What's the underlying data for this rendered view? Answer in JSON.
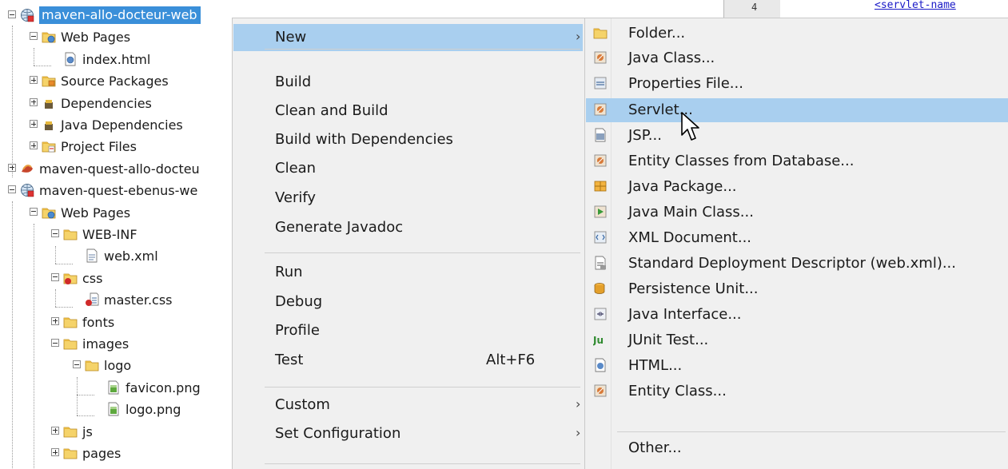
{
  "tree": {
    "items": [
      {
        "label": "maven-allo-docteur-web",
        "icon": "web-project-icon",
        "expander": "minus",
        "selected": true
      },
      {
        "label": "Web Pages",
        "icon": "web-pages-folder-icon",
        "expander": "minus"
      },
      {
        "label": "index.html",
        "icon": "html-file-icon",
        "expander": ""
      },
      {
        "label": "Source Packages",
        "icon": "source-packages-folder-icon",
        "expander": "plus"
      },
      {
        "label": "Dependencies",
        "icon": "dependencies-folder-icon",
        "expander": "plus"
      },
      {
        "label": "Java Dependencies",
        "icon": "java-dependencies-folder-icon",
        "expander": "plus"
      },
      {
        "label": "Project Files",
        "icon": "project-files-folder-icon",
        "expander": "plus"
      },
      {
        "label": "maven-quest-allo-docteu",
        "icon": "maven-project-icon",
        "expander": "plus"
      },
      {
        "label": "maven-quest-ebenus-we",
        "icon": "web-project-icon",
        "expander": "minus"
      },
      {
        "label": "Web Pages",
        "icon": "web-pages-folder-icon",
        "expander": "minus"
      },
      {
        "label": "WEB-INF",
        "icon": "folder-icon",
        "expander": "minus"
      },
      {
        "label": "web.xml",
        "icon": "xml-file-icon",
        "expander": ""
      },
      {
        "label": "css",
        "icon": "folder-error-icon",
        "expander": "minus"
      },
      {
        "label": "master.css",
        "icon": "css-file-icon",
        "expander": ""
      },
      {
        "label": "fonts",
        "icon": "folder-icon",
        "expander": "plus"
      },
      {
        "label": "images",
        "icon": "folder-icon",
        "expander": "minus"
      },
      {
        "label": "logo",
        "icon": "folder-icon",
        "expander": "minus"
      },
      {
        "label": "favicon.png",
        "icon": "image-file-icon",
        "expander": ""
      },
      {
        "label": "logo.png",
        "icon": "image-file-icon",
        "expander": ""
      },
      {
        "label": "js",
        "icon": "folder-icon",
        "expander": "plus"
      },
      {
        "label": "pages",
        "icon": "folder-icon",
        "expander": "plus"
      }
    ]
  },
  "editor": {
    "line_number": "4",
    "code": "<servlet-name"
  },
  "context_menu": {
    "items": [
      {
        "label": "New",
        "shortcut": "",
        "submenu": true,
        "highlighted": true
      },
      {
        "label": "Build",
        "shortcut": "",
        "submenu": false
      },
      {
        "label": "Clean and Build",
        "shortcut": "",
        "submenu": false
      },
      {
        "label": "Build with Dependencies",
        "shortcut": "",
        "submenu": false
      },
      {
        "label": "Clean",
        "shortcut": "",
        "submenu": false
      },
      {
        "label": "Verify",
        "shortcut": "",
        "submenu": false
      },
      {
        "label": "Generate Javadoc",
        "shortcut": "",
        "submenu": false
      },
      {
        "label": "Run",
        "shortcut": "",
        "submenu": false
      },
      {
        "label": "Debug",
        "shortcut": "",
        "submenu": false
      },
      {
        "label": "Profile",
        "shortcut": "",
        "submenu": false
      },
      {
        "label": "Test",
        "shortcut": "Alt+F6",
        "submenu": false
      },
      {
        "label": "Custom",
        "shortcut": "",
        "submenu": true
      },
      {
        "label": "Set Configuration",
        "shortcut": "",
        "submenu": true
      }
    ]
  },
  "new_submenu": {
    "items": [
      {
        "label": "Folder...",
        "icon": "folder-icon"
      },
      {
        "label": "Java Class...",
        "icon": "java-class-icon"
      },
      {
        "label": "Properties File...",
        "icon": "properties-file-icon"
      },
      {
        "label": "Servlet...",
        "icon": "servlet-icon",
        "highlighted": true
      },
      {
        "label": "JSP...",
        "icon": "jsp-icon"
      },
      {
        "label": "Entity Classes from Database...",
        "icon": "entity-classes-icon"
      },
      {
        "label": "Java Package...",
        "icon": "java-package-icon"
      },
      {
        "label": "Java Main Class...",
        "icon": "java-main-class-icon"
      },
      {
        "label": "XML Document...",
        "icon": "xml-document-icon"
      },
      {
        "label": "Standard Deployment Descriptor (web.xml)...",
        "icon": "deployment-descriptor-icon"
      },
      {
        "label": "Persistence Unit...",
        "icon": "persistence-unit-icon"
      },
      {
        "label": "Java Interface...",
        "icon": "java-interface-icon"
      },
      {
        "label": "JUnit Test...",
        "icon": "junit-icon"
      },
      {
        "label": "HTML...",
        "icon": "html-icon"
      },
      {
        "label": "Entity Class...",
        "icon": "entity-class-icon"
      },
      {
        "label": "Other...",
        "icon": ""
      }
    ]
  },
  "colors": {
    "selection": "#3a8fd9",
    "menu_highlight": "#a9cfef",
    "menu_background": "#f0f0f0"
  }
}
